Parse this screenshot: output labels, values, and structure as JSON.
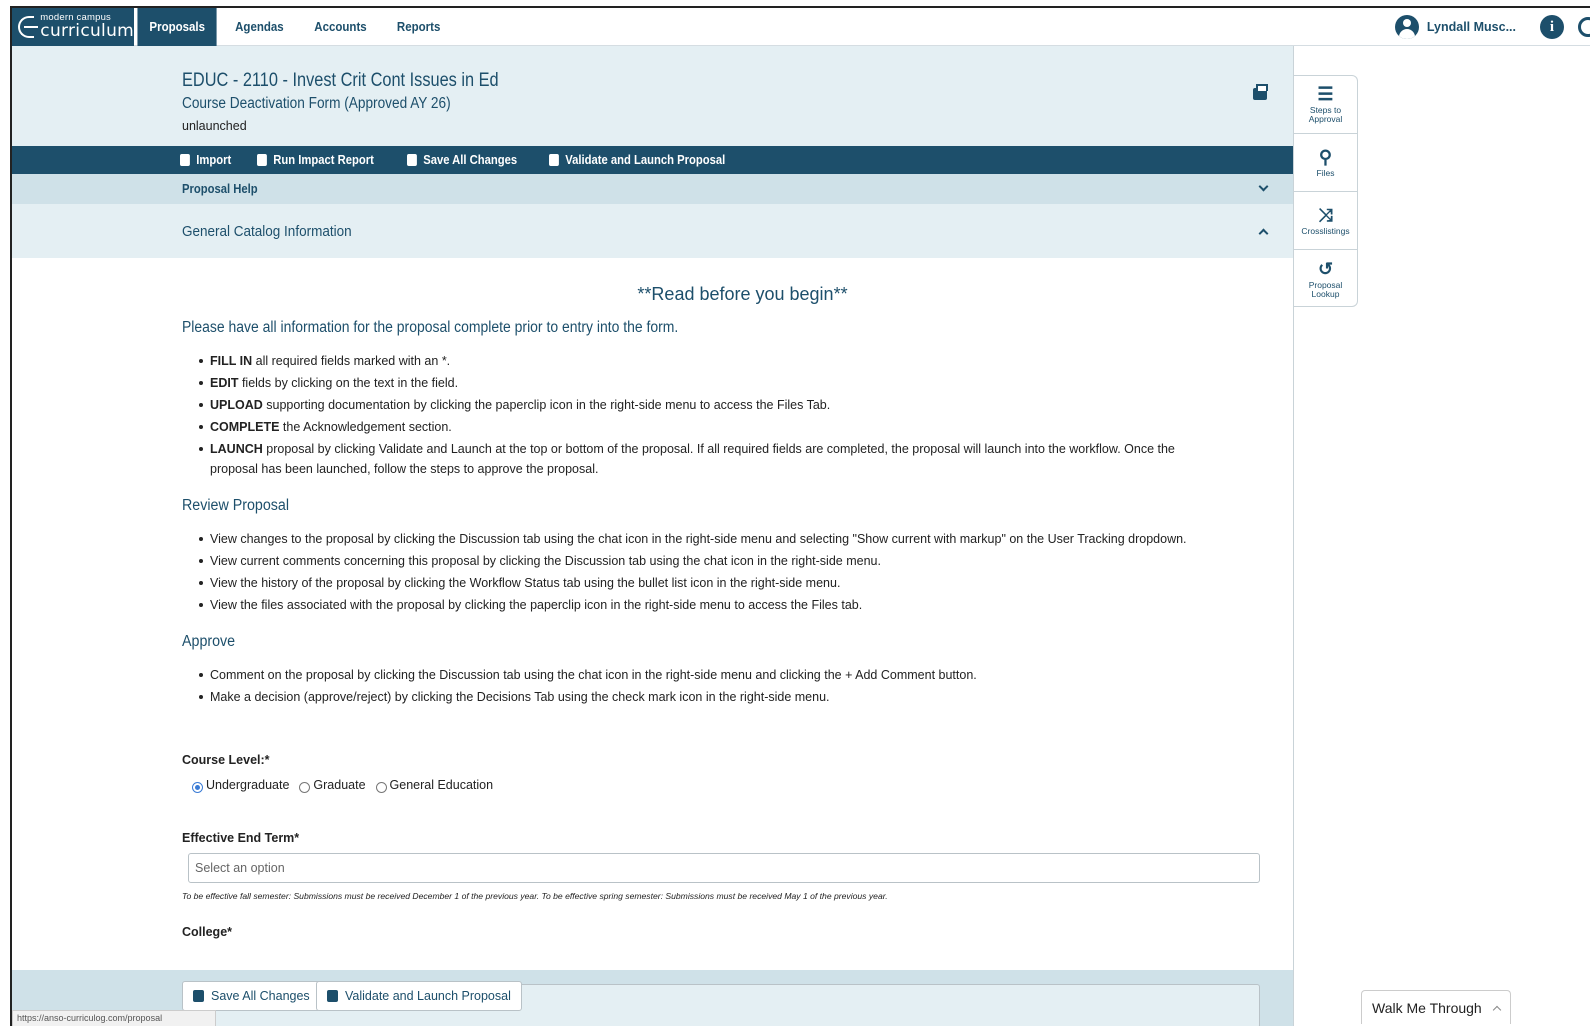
{
  "brand": {
    "small": "modern campus",
    "big": "curriculum"
  },
  "nav": {
    "tabs": [
      {
        "label": "Proposals",
        "active": true
      },
      {
        "label": "Agendas",
        "active": false
      },
      {
        "label": "Accounts",
        "active": false
      },
      {
        "label": "Reports",
        "active": false
      }
    ],
    "user_name": "Lyndall Musc...",
    "info_glyph": "i"
  },
  "header": {
    "title": "EDUC - 2110 - Invest Crit Cont Issues in Ed",
    "subtitle": "Course Deactivation Form (Approved AY 26)",
    "status": "unlaunched"
  },
  "toolbar": {
    "import": "Import",
    "impact": "Run Impact Report",
    "save": "Save All Changes",
    "validate": "Validate and Launch Proposal"
  },
  "help_bar": {
    "label": "Proposal Help"
  },
  "section": {
    "label": "General Catalog Information"
  },
  "content": {
    "read_title": "**Read before you begin**",
    "lead": "Please have all information for the proposal complete prior to entry into the form.",
    "instructions": [
      {
        "bold": "FILL IN",
        "text": " all required fields marked with an *."
      },
      {
        "bold": "EDIT",
        "text": " fields by clicking on the text in the field."
      },
      {
        "bold": "UPLOAD",
        "text": " supporting documentation by clicking the paperclip icon in the right-side menu to access the Files Tab."
      },
      {
        "bold": "COMPLETE",
        "text": " the Acknowledgement section."
      },
      {
        "bold": "LAUNCH",
        "text": " proposal by clicking Validate and Launch at the top or bottom of the proposal.  If all required fields are completed, the proposal will launch into the workflow. Once the proposal has been launched, follow the steps to approve the proposal."
      }
    ],
    "review_heading": "Review Proposal",
    "review_items": [
      "View changes to the proposal by clicking the Discussion tab using the chat icon in the right-side menu and selecting \"Show current with markup\" on the User Tracking dropdown.",
      "View current comments concerning this proposal by clicking the Discussion tab using the chat icon in the right-side menu.",
      "View the history of the proposal by clicking the Workflow Status tab using the bullet list icon in the right-side menu.",
      "View the files associated with the proposal by clicking the paperclip icon in the right-side menu to access the Files tab."
    ],
    "approve_heading": "Approve",
    "approve_items": [
      "Comment on the proposal by clicking the Discussion tab using the chat icon in the right-side menu and clicking the + Add Comment button.",
      "Make a decision (approve/reject) by clicking the Decisions Tab using the check mark icon in the right-side menu."
    ]
  },
  "form": {
    "course_level_label": "Course Level:*",
    "course_level_options": [
      "Undergraduate",
      "Graduate",
      "General Education"
    ],
    "course_level_selected": "Undergraduate",
    "end_term_label": "Effective End Term*",
    "end_term_placeholder": "Select an option",
    "end_term_helper": "To be effective fall semester: Submissions must be received December 1 of the previous year. To be effective spring semester: Submissions must be received May 1 of the previous year.",
    "college_label": "College*"
  },
  "floating": {
    "save": "Save All Changes",
    "validate": "Validate and Launch Proposal"
  },
  "status_url": "https://anso-curriculog.com/proposal",
  "rail": [
    {
      "icon": "list-icon",
      "label": "Steps to Approval"
    },
    {
      "icon": "paperclip-icon",
      "label": "Files"
    },
    {
      "icon": "shuffle-icon",
      "label": "Crosslistings"
    },
    {
      "icon": "history-icon",
      "label": "Proposal Lookup"
    }
  ],
  "walk_me": "Walk Me Through",
  "colors": {
    "brand": "#1d4f6b",
    "band": "#e4eff3",
    "help": "#cfe1e8"
  }
}
